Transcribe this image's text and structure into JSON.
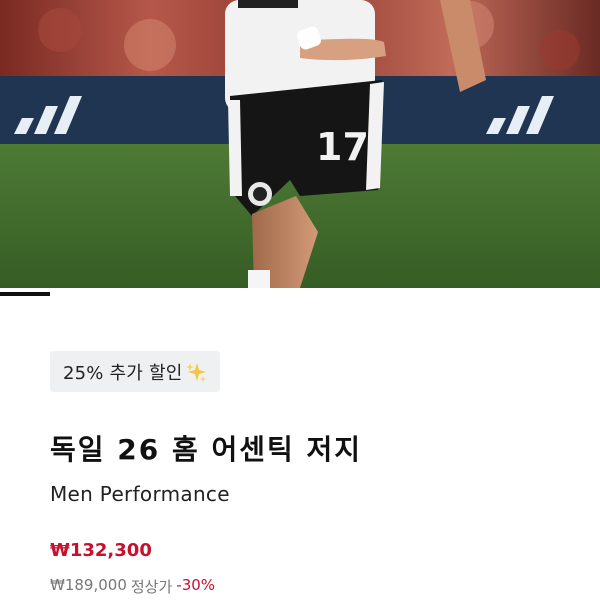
{
  "product": {
    "promo_badge": "25% 추가 할인",
    "promo_badge_icon": "sparkles-icon",
    "title": "독일 26 홈 어센틱 저지",
    "category": "Men Performance",
    "price": "₩132,300",
    "original_price": "₩189,000",
    "original_price_label": "정상가",
    "discount_rate": "-30%"
  },
  "hero": {
    "jersey_number": "17"
  },
  "gallery": {
    "active_index": 1
  },
  "colors": {
    "accent_sale": "#c8102e",
    "badge_bg": "#eef0f2",
    "pitch_green": "#3f6b2c"
  }
}
